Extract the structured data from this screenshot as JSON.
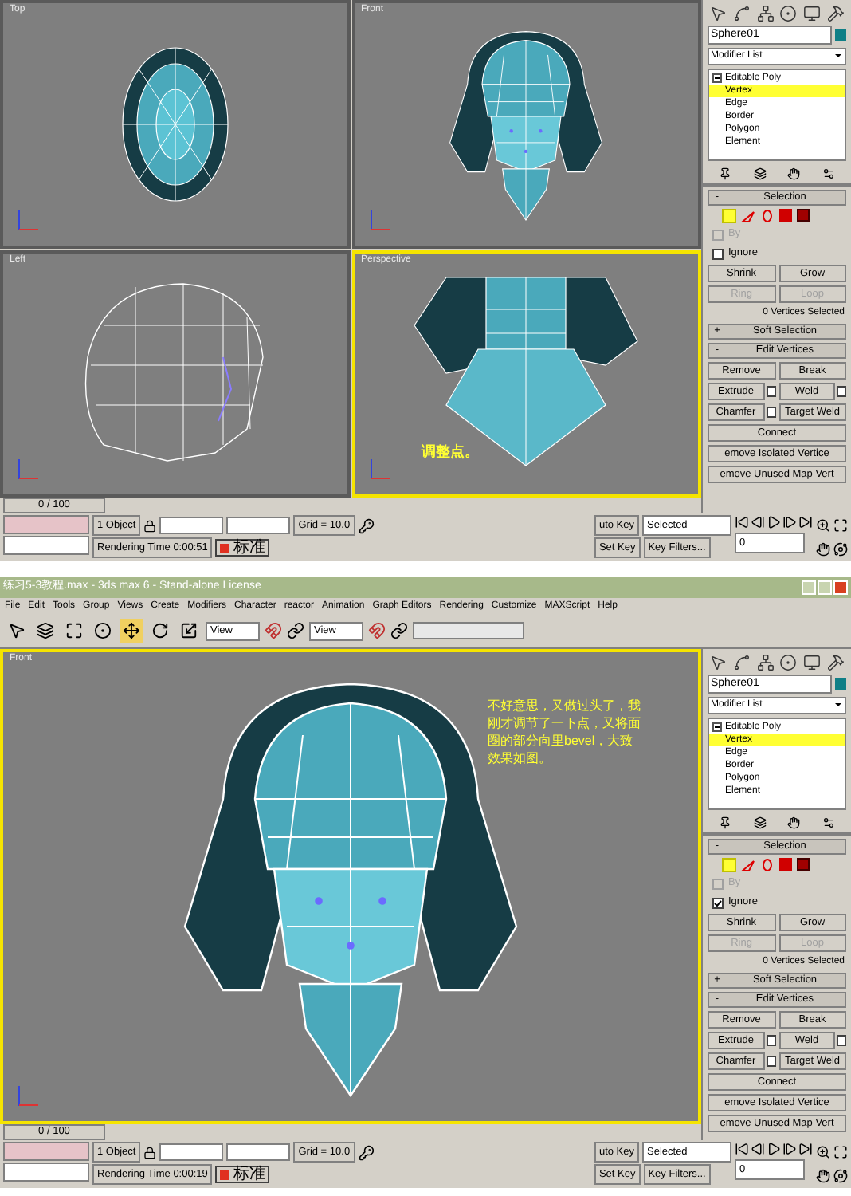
{
  "screens": [
    {
      "viewports": [
        {
          "label": "Top",
          "kind": "top",
          "active": false
        },
        {
          "label": "Front",
          "kind": "front",
          "active": false
        },
        {
          "label": "Left",
          "kind": "left",
          "active": false
        },
        {
          "label": "Perspective",
          "kind": "perspective",
          "active": true,
          "annotation": "调整点。"
        }
      ],
      "timeline": {
        "label": "0 / 100",
        "level": 0
      },
      "panel": {
        "object_name": "Sphere01",
        "modifier_list": "Modifier List",
        "stack": [
          {
            "label": "Editable Poly",
            "children": [
              {
                "label": "Vertex",
                "selected": true
              },
              {
                "label": "Edge",
                "selected": false
              },
              {
                "label": "Border",
                "selected": false
              },
              {
                "label": "Polygon",
                "selected": false
              },
              {
                "label": "Element",
                "selected": false
              }
            ]
          }
        ],
        "selection": {
          "sign": "-",
          "title": "Selection",
          "by": {
            "label": "By",
            "checked": false,
            "disabled": true
          },
          "ignore": {
            "label": "Ignore",
            "checked": false,
            "disabled": false
          },
          "buttons": [
            {
              "label": "Shrink",
              "disabled": false
            },
            {
              "label": "Grow",
              "disabled": false
            },
            {
              "label": "Ring",
              "disabled": true
            },
            {
              "label": "Loop",
              "disabled": true
            }
          ],
          "summary": "0 Vertices Selected"
        },
        "soft_selection": {
          "sign": "+",
          "title": "Soft Selection"
        },
        "edit_vertices": {
          "sign": "-",
          "title": "Edit Vertices",
          "buttons": [
            {
              "label": "Remove",
              "settings": false
            },
            {
              "label": "Break",
              "settings": false
            },
            {
              "label": "Extrude",
              "settings": true
            },
            {
              "label": "Weld",
              "settings": true
            },
            {
              "label": "Chamfer",
              "settings": true
            },
            {
              "label": "Target Weld",
              "settings": false
            },
            {
              "label": "Connect",
              "settings": false
            },
            {
              "label": "emove Isolated Vertice",
              "settings": false
            },
            {
              "label": "emove Unused Map Vert",
              "settings": false
            }
          ]
        }
      },
      "status": {
        "objects": "1 Object",
        "render_time": "Rendering Time  0:00:51",
        "grid": "Grid = 10.0",
        "auto_key": "uto Key",
        "key_mode": "Selected",
        "set_key": "Set Key",
        "key_filters": "Key Filters...",
        "frame": "0",
        "ime": "标准"
      }
    },
    {
      "title": "练习5-3教程.max - 3ds max 6 - Stand-alone License",
      "menu": [
        "File",
        "Edit",
        "Tools",
        "Group",
        "Views",
        "Create",
        "Modifiers",
        "Character",
        "reactor",
        "Animation",
        "Graph Editors",
        "Rendering",
        "Customize",
        "MAXScript",
        "Help"
      ],
      "toolbar": {
        "tools": [
          {
            "selected": false
          },
          {
            "selected": false
          },
          {
            "selected": false
          },
          {
            "selected": false
          },
          {
            "selected": true
          },
          {
            "selected": false
          },
          {
            "selected": false
          }
        ],
        "view_dropdowns": [
          "View",
          "View"
        ]
      },
      "viewports": [
        {
          "label": "Front",
          "kind": "front_large",
          "active": true,
          "annotation": "不好意思，又做过头了，我刚才调节了一下点，又将面圈的部分向里bevel，大致效果如图。"
        }
      ],
      "timeline": {
        "label": "0 / 100",
        "level": 0
      },
      "panel": {
        "object_name": "Sphere01",
        "modifier_list": "Modifier List",
        "stack": [
          {
            "label": "Editable Poly",
            "children": [
              {
                "label": "Vertex",
                "selected": true
              },
              {
                "label": "Edge",
                "selected": false
              },
              {
                "label": "Border",
                "selected": false
              },
              {
                "label": "Polygon",
                "selected": false
              },
              {
                "label": "Element",
                "selected": false
              }
            ]
          }
        ],
        "selection": {
          "sign": "-",
          "title": "Selection",
          "by": {
            "label": "By",
            "checked": false,
            "disabled": true
          },
          "ignore": {
            "label": "Ignore",
            "checked": true,
            "disabled": false
          },
          "buttons": [
            {
              "label": "Shrink",
              "disabled": false
            },
            {
              "label": "Grow",
              "disabled": false
            },
            {
              "label": "Ring",
              "disabled": true
            },
            {
              "label": "Loop",
              "disabled": true
            }
          ],
          "summary": "0 Vertices Selected"
        },
        "soft_selection": {
          "sign": "+",
          "title": "Soft Selection"
        },
        "edit_vertices": {
          "sign": "-",
          "title": "Edit Vertices",
          "buttons": [
            {
              "label": "Remove",
              "settings": false
            },
            {
              "label": "Break",
              "settings": false
            },
            {
              "label": "Extrude",
              "settings": true
            },
            {
              "label": "Weld",
              "settings": true
            },
            {
              "label": "Chamfer",
              "settings": true
            },
            {
              "label": "Target Weld",
              "settings": false
            },
            {
              "label": "Connect",
              "settings": false
            },
            {
              "label": "emove Isolated Vertice",
              "settings": false
            },
            {
              "label": "emove Unused Map Vert",
              "settings": false
            }
          ]
        }
      },
      "status": {
        "objects": "1 Object",
        "render_time": "Rendering Time  0:00:19",
        "grid": "Grid = 10.0",
        "auto_key": "uto Key",
        "key_mode": "Selected",
        "set_key": "Set Key",
        "key_filters": "Key Filters...",
        "frame": "0",
        "ime": "标准"
      }
    }
  ]
}
